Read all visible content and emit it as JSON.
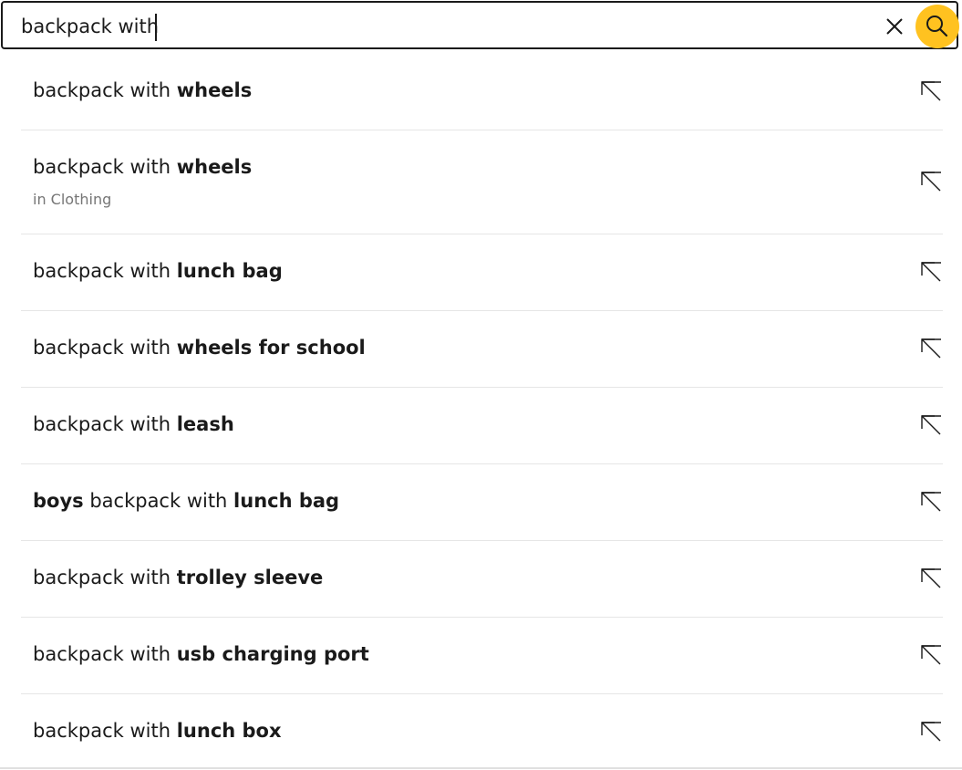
{
  "search": {
    "value": "backpack with",
    "clear_icon": "close-icon",
    "search_icon": "search-icon",
    "accent_color": "#ffc220"
  },
  "suggestions": [
    {
      "parts": [
        {
          "t": "backpack with ",
          "b": false
        },
        {
          "t": "wheels",
          "b": true
        }
      ],
      "dept": "",
      "icon": "arrow-up-left-icon"
    },
    {
      "parts": [
        {
          "t": "backpack with ",
          "b": false
        },
        {
          "t": "wheels",
          "b": true
        }
      ],
      "dept": "in Clothing",
      "icon": "arrow-up-left-icon"
    },
    {
      "parts": [
        {
          "t": "backpack with ",
          "b": false
        },
        {
          "t": "lunch bag",
          "b": true
        }
      ],
      "dept": "",
      "icon": "arrow-up-left-icon"
    },
    {
      "parts": [
        {
          "t": "backpack with ",
          "b": false
        },
        {
          "t": "wheels for school",
          "b": true
        }
      ],
      "dept": "",
      "icon": "arrow-up-left-icon"
    },
    {
      "parts": [
        {
          "t": "backpack with ",
          "b": false
        },
        {
          "t": "leash",
          "b": true
        }
      ],
      "dept": "",
      "icon": "arrow-up-left-icon"
    },
    {
      "parts": [
        {
          "t": "boys",
          "b": true
        },
        {
          "t": " backpack with ",
          "b": false
        },
        {
          "t": "lunch bag",
          "b": true
        }
      ],
      "dept": "",
      "icon": "arrow-up-left-icon"
    },
    {
      "parts": [
        {
          "t": "backpack with ",
          "b": false
        },
        {
          "t": "trolley sleeve",
          "b": true
        }
      ],
      "dept": "",
      "icon": "arrow-up-left-icon"
    },
    {
      "parts": [
        {
          "t": "backpack with ",
          "b": false
        },
        {
          "t": "usb charging port",
          "b": true
        }
      ],
      "dept": "",
      "icon": "arrow-up-left-icon"
    },
    {
      "parts": [
        {
          "t": "backpack with ",
          "b": false
        },
        {
          "t": "lunch box",
          "b": true
        }
      ],
      "dept": "",
      "icon": "arrow-up-left-icon"
    }
  ]
}
